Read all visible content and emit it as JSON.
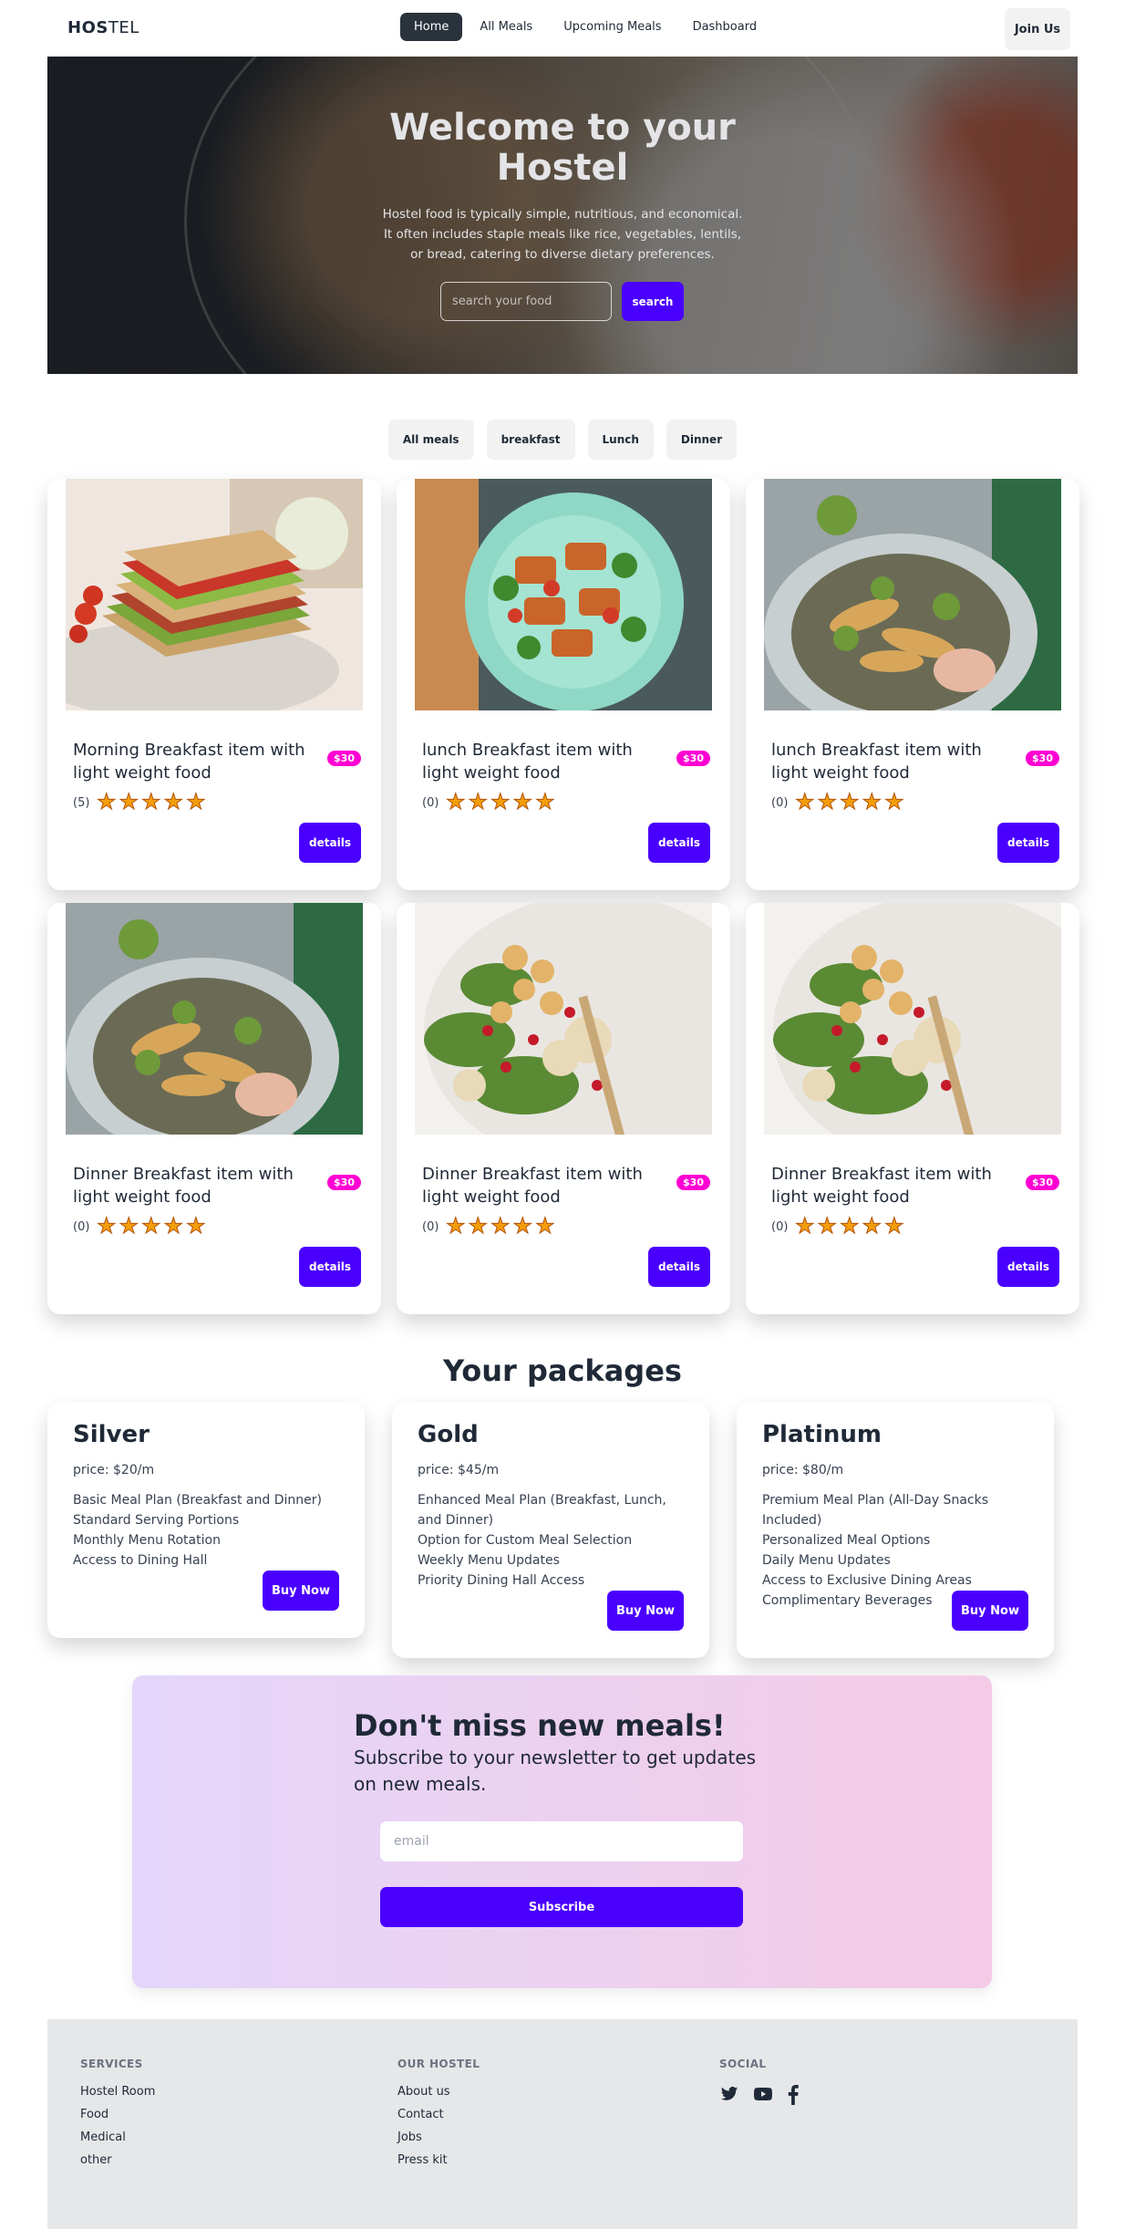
{
  "nav": {
    "logo_bold": "HOS",
    "logo_rest": "TEL",
    "links": [
      "Home",
      "All Meals",
      "Upcoming Meals",
      "Dashboard"
    ],
    "join": "Join Us"
  },
  "hero": {
    "title": "Welcome to your Hostel",
    "description": "Hostel food is typically simple, nutritious, and economical. It often includes staple meals like rice, vegetables, lentils, or bread, catering to diverse dietary preferences.",
    "search_placeholder": "search your food",
    "search_button": "search"
  },
  "filters": [
    "All meals",
    "breakfast",
    "Lunch",
    "Dinner"
  ],
  "meals": [
    {
      "title": "Morning Breakfast item with light weight food",
      "price": "$30",
      "count": "(5)",
      "details": "details",
      "image": "sandwich"
    },
    {
      "title": "lunch Breakfast item with light weight food",
      "price": "$30",
      "count": "(0)",
      "details": "details",
      "image": "halloumi-salad"
    },
    {
      "title": "lunch Breakfast item with light weight food",
      "price": "$30",
      "count": "(0)",
      "details": "details",
      "image": "leafy-salad"
    },
    {
      "title": "Dinner Breakfast item with light weight food",
      "price": "$30",
      "count": "(0)",
      "details": "details",
      "image": "leafy-salad"
    },
    {
      "title": "Dinner Breakfast item with light weight food",
      "price": "$30",
      "count": "(0)",
      "details": "details",
      "image": "cauliflower-salad"
    },
    {
      "title": "Dinner Breakfast item with light weight food",
      "price": "$30",
      "count": "(0)",
      "details": "details",
      "image": "cauliflower-salad"
    }
  ],
  "packages": {
    "title": "Your packages",
    "items": [
      {
        "name": "Silver",
        "price": "price: $20/m",
        "features": [
          "Basic Meal Plan (Breakfast and Dinner)",
          "Standard Serving Portions",
          "Monthly Menu Rotation",
          "Access to Dining Hall"
        ],
        "button": "Buy Now"
      },
      {
        "name": "Gold",
        "price": "price: $45/m",
        "features": [
          "Enhanced Meal Plan (Breakfast, Lunch, and Dinner)",
          "Option for Custom Meal Selection",
          "Weekly Menu Updates",
          "Priority Dining Hall Access"
        ],
        "button": "Buy Now"
      },
      {
        "name": "Platinum",
        "price": "price: $80/m",
        "features": [
          "Premium Meal Plan (All-Day Snacks Included)",
          "Personalized Meal Options",
          "Daily Menu Updates",
          "Access to Exclusive Dining Areas",
          "Complimentary Beverages"
        ],
        "button": "Buy Now"
      }
    ]
  },
  "newsletter": {
    "title": "Don't miss new meals!",
    "subtitle": "Subscribe to your newsletter to get updates on new meals.",
    "email_placeholder": "email",
    "button": "Subscribe"
  },
  "footer": {
    "services": {
      "heading": "SERVICES",
      "links": [
        "Hostel Room",
        "Food",
        "Medical",
        "other"
      ]
    },
    "hostel": {
      "heading": "OUR HOSTEL",
      "links": [
        "About us",
        "Contact",
        "Jobs",
        "Press kit"
      ]
    },
    "social": {
      "heading": "SOCIAL",
      "icons": [
        "twitter-icon",
        "youtube-icon",
        "facebook-icon"
      ]
    }
  },
  "colors": {
    "accent": "#4a00ff",
    "badge": "#ff00d3",
    "nav_active": "#2a323c",
    "star": "#f59e0b"
  }
}
